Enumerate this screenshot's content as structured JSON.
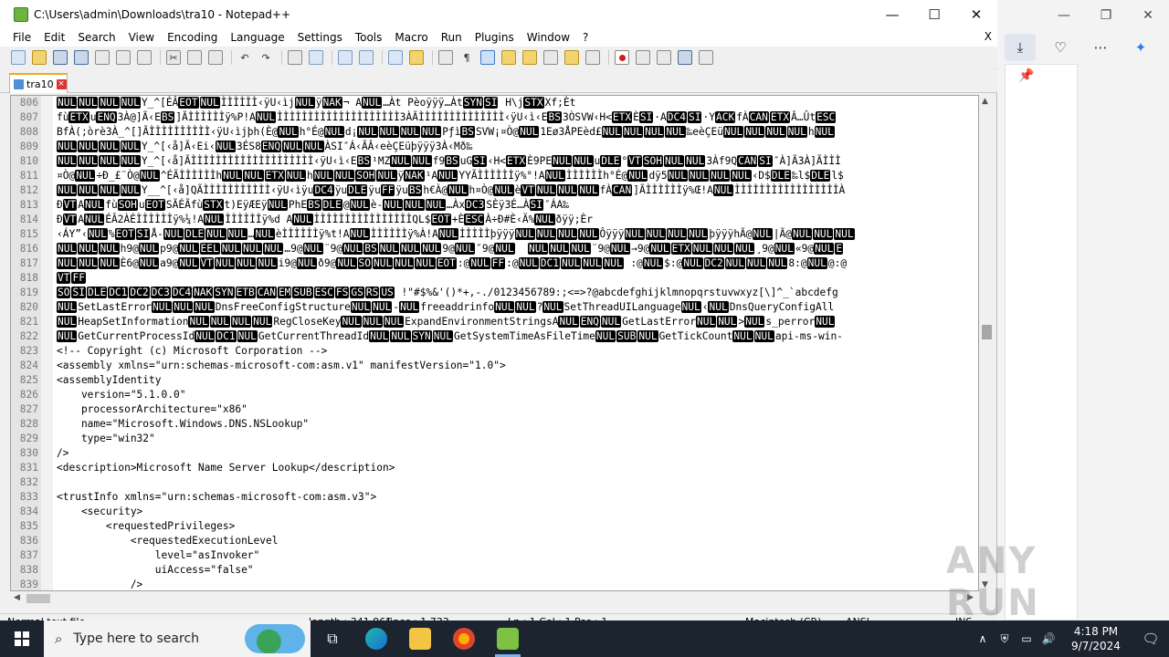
{
  "window": {
    "title": "C:\\Users\\admin\\Downloads\\tra10 - Notepad++",
    "min": "—",
    "max": "☐",
    "close": "✕"
  },
  "menu": [
    "File",
    "Edit",
    "Search",
    "View",
    "Encoding",
    "Language",
    "Settings",
    "Tools",
    "Macro",
    "Run",
    "Plugins",
    "Window",
    "?"
  ],
  "menu_close": "X",
  "tab": {
    "label": "tra10"
  },
  "editor": {
    "lines": [
      {
        "n": "806",
        "t": "⟨NUL⟩⟨NUL⟩⟨NUL⟩⟨NUL⟩Y_^[ÉÂ⟨EOT⟩⟨NUL⟩ÌÌÌÌÌÌ‹ÿU‹ìj⟨NUL⟩ÿ⟨NAK⟩¬ A⟨NUL⟩…Àt Pèoÿÿÿ…Àt⟨SYN⟩⟨SI⟩ H\\j⟨STX⟩Xf;Èt"
      },
      {
        "n": "807",
        "t": "fù⟨ETX⟩u⟨ENQ⟩3À@]Ã‹E⟨BS⟩]ÃÌÌÌÌÌÌÿ%P!A⟨NUL⟩ÌÌÌÌÌÌÌÌÌÌÌÌÌÌÌÌÌÌÌÌ3ÀÃÌÌÌÌÌÌÌÌÌÌÌÌÌÌ‹ÿU‹ì‹E⟨BS⟩3ÒSVW‹H<⟨ETX⟩È⟨SI⟩·A⟨DC4⟩⟨SI⟩·Y⟨ACK⟩fÀ⟨CAN⟩⟨ETX⟩Â…Ût⟨ESC⟩"
      },
      {
        "n": "808",
        "t": "BfÀ(;òrè3À_^[]ÃÌÌÌÌÌÌÌÌÌÌ‹ÿU‹ìjþh(È@⟨NUL⟩h°É@⟨NUL⟩d¡⟨NUL⟩⟨NUL⟩⟨NUL⟩⟨NUL⟩Pƒì⟨BS⟩SVW¡¤Ò@⟨NUL⟩1Eø3ÅPEèd£⟨NUL⟩⟨NUL⟩⟨NUL⟩⟨NUL⟩‰eèÇEü⟨NUL⟩⟨NUL⟩⟨NUL⟩⟨NUL⟩h⟨NUL⟩"
      },
      {
        "n": "809",
        "t": "⟨NUL⟩⟨NUL⟩⟨NUL⟩⟨NUL⟩Y_^[‹å]Ã‹Ei‹⟨NUL⟩3ÉS8⟨ENQ⟩⟨NUL⟩⟨NUL⟩ÀSI″Á‹ÃÂ‹eèÇEüþÿÿÿ3À‹Mð‰"
      },
      {
        "n": "810",
        "t": "⟨NUL⟩⟨NUL⟩⟨NUL⟩⟨NUL⟩Y_^[‹å]ÃÌÌÌÌÌÌÌÌÌÌÌÌÌÌÌÌÌÌÌÌ‹ÿU‹ì‹E⟨BS⟩¹MZ⟨NUL⟩⟨NUL⟩f9⟨BS⟩uG⟨SI⟩‹H<⟨ETX⟩È9PE⟨NUL⟩⟨NUL⟩u⟨DLE⟩°⟨VT⟩⟨SOH⟩⟨NUL⟩⟨NUL⟩3Àf9Q⟨CAN⟩⟨SI⟩″À]Ã3À]ÃÌÌÌ"
      },
      {
        "n": "811",
        "t": "¤Ò@⟨NUL⟩÷Ð_£¨Ò@⟨NUL⟩^ÉÃÌÌÌÌÌÌh⟨NUL⟩⟨NUL⟩⟨ETX⟩⟨NUL⟩h⟨NUL⟩⟨NUL⟩⟨SOH⟩⟨NUL⟩ÿ⟨NAK⟩¹A⟨NUL⟩YYÃÌÌÌÌÌÌÿ%°!A⟨NUL⟩ÌÌÌÌÌÌh°É@⟨NUL⟩dÿ5⟨NUL⟩⟨NUL⟩⟨NUL⟩⟨NUL⟩‹D$⟨DLE⟩‰l$⟨DLE⟩l$"
      },
      {
        "n": "812",
        "t": "⟨NUL⟩⟨NUL⟩⟨NUL⟩⟨NUL⟩Y__^[‹å]QÃÌÌÌÌÌÌÌÌÌÌÌ‹ÿU‹ìÿu⟨DC4⟩ÿu⟨DLE⟩ÿu⟨FF⟩ÿu⟨BS⟩h€À@⟨NUL⟩h¤Ò@⟨NUL⟩è⟨VT⟩⟨NUL⟩⟨NUL⟩⟨NUL⟩fÀ⟨CAN⟩]ÃÌÌÌÌÌÌÿ%Œ!A⟨NUL⟩ÌÌÌÌÌÌÌÌÌÌÌÌÌÌÌÌÌÀ"
      },
      {
        "n": "813",
        "t": "Ð⟨VT⟩A⟨NUL⟩fù⟨SOH⟩u⟨EOT⟩SÃÉÃfù⟨STX⟩t)EÿÆEÿ⟨NUL⟩PhE⟨BS⟩⟨DLE⟩@⟨NUL⟩è-⟨NUL⟩⟨NUL⟩⟨NUL⟩…Àx⟨DC3⟩SÈÿ3É…À⟨SI⟩″ÁA‰"
      },
      {
        "n": "814",
        "t": "Ð⟨VT⟩A⟨NUL⟩ÉÂ2ÀÉÌÌÌÌÌÌÿ%¼!A⟨NUL⟩ÌÌÌÌÌÌÿ%d A⟨NUL⟩ÌÌÌÌÌÌÌÌÌÌÌÌÌÌÌÌQL$⟨EOT⟩+È⟨ESC⟩À÷Ð#È‹Ä%⟨NUL⟩ðÿÿ;Èr"
      },
      {
        "n": "815",
        "t": "‹ÁY”‹⟨NUL⟩%⟨EOT⟩⟨SI⟩Å-⟨NUL⟩⟨DLE⟩⟨NUL⟩⟨NUL⟩…⟨NUL⟩èÌÌÌÌÌÌÿ%t!A⟨NUL⟩ÌÌÌÌÌÌÿ%À!A⟨NUL⟩ÌÌÌÌÌþÿÿÿ⟨NUL⟩⟨NUL⟩⟨NUL⟩⟨NUL⟩Ôÿÿÿ⟨NUL⟩⟨NUL⟩⟨NUL⟩⟨NUL⟩þÿÿÿhÃ@⟨NUL⟩|Ã@⟨NUL⟩⟨NUL⟩⟨NUL⟩"
      },
      {
        "n": "816",
        "t": "⟨NUL⟩⟨NUL⟩⟨NUL⟩h9@⟨NUL⟩p9@⟨NUL⟩⟨EEL⟩⟨NUL⟩⟨NUL⟩⟨NUL⟩…9@⟨NUL⟩¨9@⟨NUL⟩⟨BS⟩⟨NUL⟩⟨NUL⟩⟨NUL⟩9@⟨NUL⟩″9@⟨NUL⟩  ⟨NUL⟩⟨NUL⟩⟨NUL⟩¨9@⟨NUL⟩→9@⟨NUL⟩⟨ETX⟩⟨NUL⟩⟨NUL⟩⟨NUL⟩¸9@⟨NUL⟩«9@⟨NUL⟩⟨E⟩"
      },
      {
        "n": "817",
        "t": "⟨NUL⟩⟨NUL⟩⟨NUL⟩È6@⟨NUL⟩a9@⟨NUL⟩⟨VT⟩⟨NUL⟩⟨NUL⟩⟨NUL⟩i9@⟨NUL⟩ð9@⟨NUL⟩⟨SO⟩⟨NUL⟩⟨NUL⟩⟨NUL⟩⟨EOT⟩:@⟨NUL⟩⟨FF⟩:@⟨NUL⟩⟨DC1⟩⟨NUL⟩⟨NUL⟩⟨NUL⟩ :@⟨NUL⟩$:@⟨NUL⟩⟨DC2⟩⟨NUL⟩⟨NUL⟩⟨NUL⟩8:@⟨NUL⟩@:@"
      },
      {
        "n": "818",
        "t": "⟨VT⟩⟨FF⟩"
      },
      {
        "n": "819",
        "t": "⟨SO⟩⟨SI⟩⟨DLE⟩⟨DC1⟩⟨DC2⟩⟨DC3⟩⟨DC4⟩⟨NAK⟩⟨SYN⟩⟨ETB⟩⟨CAN⟩⟨EM⟩⟨SUB⟩⟨ESC⟩⟨FS⟩⟨GS⟩⟨RS⟩⟨US⟩ !\"#$%&'()*+,-./0123456789:;<=>?@abcdefghijklmnopqrstuvwxyz[\\]^_`abcdefg"
      },
      {
        "n": "820",
        "t": "⟨NUL⟩SetLastError⟨NUL⟩⟨NUL⟩⟨NUL⟩DnsFreeConfigStructure⟨NUL⟩⟨NUL⟩-⟨NUL⟩freeaddrinfo⟨NUL⟩⟨NUL⟩?⟨NUL⟩SetThreadUILanguage⟨NUL⟩‹⟨NUL⟩DnsQueryConfigAll"
      },
      {
        "n": "821",
        "t": "⟨NUL⟩HeapSetInformation⟨NUL⟩⟨NUL⟩⟨NUL⟩⟨NUL⟩RegCloseKey⟨NUL⟩⟨NUL⟩⟨NUL⟩ExpandEnvironmentStringsA⟨NUL⟩⟨ENQ⟩⟨NUL⟩GetLastError⟨NUL⟩⟨NUL⟩>⟨NUL⟩s_perror⟨NUL⟩"
      },
      {
        "n": "822",
        "t": "⟨NUL⟩GetCurrentProcessId⟨NUL⟩⟨DC1⟩⟨NUL⟩GetCurrentThreadId⟨NUL⟩⟨NUL⟩⟨SYN⟩⟨NUL⟩GetSystemTimeAsFileTime⟨NUL⟩⟨SUB⟩⟨NUL⟩GetTickCount⟨NUL⟩⟨NUL⟩api-ms-win-"
      },
      {
        "n": "823",
        "t": "<!-- Copyright (c) Microsoft Corporation -->"
      },
      {
        "n": "824",
        "t": "<assembly xmlns=\"urn:schemas-microsoft-com:asm.v1\" manifestVersion=\"1.0\">"
      },
      {
        "n": "825",
        "t": "<assemblyIdentity"
      },
      {
        "n": "826",
        "t": "    version=\"5.1.0.0\""
      },
      {
        "n": "827",
        "t": "    processorArchitecture=\"x86\""
      },
      {
        "n": "828",
        "t": "    name=\"Microsoft.Windows.DNS.NSLookup\""
      },
      {
        "n": "829",
        "t": "    type=\"win32\""
      },
      {
        "n": "830",
        "t": "/>"
      },
      {
        "n": "831",
        "t": "<description>Microsoft Name Server Lookup</description>"
      },
      {
        "n": "832",
        "t": ""
      },
      {
        "n": "833",
        "t": "<trustInfo xmlns=\"urn:schemas-microsoft-com:asm.v3\">"
      },
      {
        "n": "834",
        "t": "    <security>"
      },
      {
        "n": "835",
        "t": "        <requestedPrivileges>"
      },
      {
        "n": "836",
        "t": "            <requestedExecutionLevel"
      },
      {
        "n": "837",
        "t": "                level=\"asInvoker\""
      },
      {
        "n": "838",
        "t": "                uiAccess=\"false\""
      },
      {
        "n": "839",
        "t": "            />"
      }
    ]
  },
  "status": {
    "doc_type": "Normal text file",
    "length": "length : 341,965",
    "lines": "lines : 1,733",
    "pos": "Ln : 1    Col : 1    Pos : 1",
    "eol": "Macintosh (CR)",
    "encoding": "ANSI",
    "mode": "INS"
  },
  "taskbar": {
    "search_placeholder": "Type here to search",
    "time": "4:18 PM",
    "date": "9/7/2024"
  },
  "watermark": "ANY RUN",
  "colors": {
    "tab_accent": "#f5a623",
    "taskbar": "#1c2430",
    "control_char_bg": "#000000"
  }
}
